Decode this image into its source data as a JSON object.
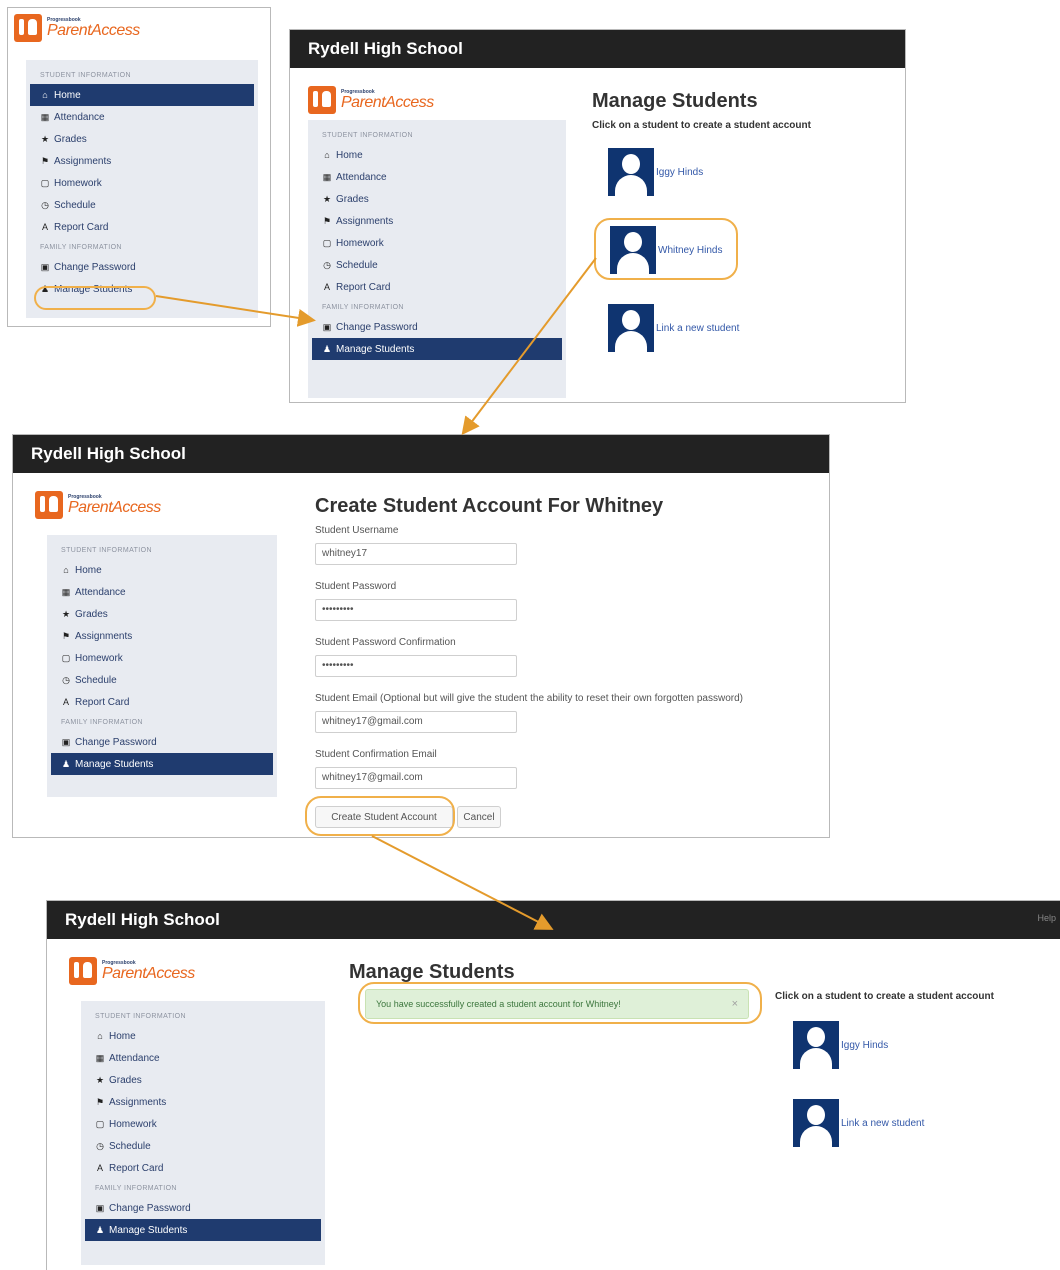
{
  "panel1": {
    "logo_small": "Progressbook",
    "logo_big": "ParentAccess",
    "sections": [
      {
        "heading": "STUDENT INFORMATION",
        "items": [
          {
            "label": "Home",
            "icon": "home-icon",
            "glyph": "⌂",
            "active": true
          },
          {
            "label": "Attendance",
            "icon": "calendar-icon",
            "glyph": "▦"
          },
          {
            "label": "Grades",
            "icon": "star-icon",
            "glyph": "★"
          },
          {
            "label": "Assignments",
            "icon": "flag-icon",
            "glyph": "⚑"
          },
          {
            "label": "Homework",
            "icon": "book-icon",
            "glyph": "▢"
          },
          {
            "label": "Schedule",
            "icon": "clock-icon",
            "glyph": "◷"
          },
          {
            "label": "Report Card",
            "icon": "report-card-icon",
            "glyph": "A"
          }
        ]
      },
      {
        "heading": "FAMILY INFORMATION",
        "items": [
          {
            "label": "Change Password",
            "icon": "lock-icon",
            "glyph": "▣"
          },
          {
            "label": "Manage Students",
            "icon": "user-icon",
            "glyph": "♟"
          }
        ]
      }
    ]
  },
  "panel2": {
    "school": "Rydell High School",
    "logo_small": "Progressbook",
    "logo_big": "ParentAccess",
    "sections": [
      {
        "heading": "STUDENT INFORMATION",
        "items": [
          {
            "label": "Home",
            "icon": "home-icon",
            "glyph": "⌂"
          },
          {
            "label": "Attendance",
            "icon": "calendar-icon",
            "glyph": "▦"
          },
          {
            "label": "Grades",
            "icon": "star-icon",
            "glyph": "★"
          },
          {
            "label": "Assignments",
            "icon": "flag-icon",
            "glyph": "⚑"
          },
          {
            "label": "Homework",
            "icon": "book-icon",
            "glyph": "▢"
          },
          {
            "label": "Schedule",
            "icon": "clock-icon",
            "glyph": "◷"
          },
          {
            "label": "Report Card",
            "icon": "report-card-icon",
            "glyph": "A"
          }
        ]
      },
      {
        "heading": "FAMILY INFORMATION",
        "items": [
          {
            "label": "Change Password",
            "icon": "lock-icon",
            "glyph": "▣"
          },
          {
            "label": "Manage Students",
            "icon": "user-icon",
            "glyph": "♟",
            "active": true
          }
        ]
      }
    ],
    "title": "Manage Students",
    "hint": "Click on a student to create a student account",
    "students": [
      "Iggy Hinds",
      "Whitney Hinds",
      "Link a new student"
    ]
  },
  "panel3": {
    "school": "Rydell High School",
    "logo_small": "Progressbook",
    "logo_big": "ParentAccess",
    "sections": [
      {
        "heading": "STUDENT INFORMATION",
        "items": [
          {
            "label": "Home",
            "icon": "home-icon",
            "glyph": "⌂"
          },
          {
            "label": "Attendance",
            "icon": "calendar-icon",
            "glyph": "▦"
          },
          {
            "label": "Grades",
            "icon": "star-icon",
            "glyph": "★"
          },
          {
            "label": "Assignments",
            "icon": "flag-icon",
            "glyph": "⚑"
          },
          {
            "label": "Homework",
            "icon": "book-icon",
            "glyph": "▢"
          },
          {
            "label": "Schedule",
            "icon": "clock-icon",
            "glyph": "◷"
          },
          {
            "label": "Report Card",
            "icon": "report-card-icon",
            "glyph": "A"
          }
        ]
      },
      {
        "heading": "FAMILY INFORMATION",
        "items": [
          {
            "label": "Change Password",
            "icon": "lock-icon",
            "glyph": "▣"
          },
          {
            "label": "Manage Students",
            "icon": "user-icon",
            "glyph": "♟",
            "active": true
          }
        ]
      }
    ],
    "title": "Create Student Account For Whitney",
    "fields": [
      {
        "label": "Student Username",
        "value": "whitney17"
      },
      {
        "label": "Student Password",
        "value": "•••••••••"
      },
      {
        "label": "Student Password Confirmation",
        "value": "•••••••••"
      },
      {
        "label": "Student Email (Optional but will give the student the ability to reset their own forgotten password)",
        "value": "whitney17@gmail.com"
      },
      {
        "label": "Student Confirmation Email",
        "value": "whitney17@gmail.com"
      }
    ],
    "create_label": "Create Student Account",
    "cancel_label": "Cancel"
  },
  "panel4": {
    "school": "Rydell High School",
    "help": "Help",
    "logo_small": "Progressbook",
    "logo_big": "ParentAccess",
    "sections": [
      {
        "heading": "STUDENT INFORMATION",
        "items": [
          {
            "label": "Home",
            "icon": "home-icon",
            "glyph": "⌂"
          },
          {
            "label": "Attendance",
            "icon": "calendar-icon",
            "glyph": "▦"
          },
          {
            "label": "Grades",
            "icon": "star-icon",
            "glyph": "★"
          },
          {
            "label": "Assignments",
            "icon": "flag-icon",
            "glyph": "⚑"
          },
          {
            "label": "Homework",
            "icon": "book-icon",
            "glyph": "▢"
          },
          {
            "label": "Schedule",
            "icon": "clock-icon",
            "glyph": "◷"
          },
          {
            "label": "Report Card",
            "icon": "report-card-icon",
            "glyph": "A"
          }
        ]
      },
      {
        "heading": "FAMILY INFORMATION",
        "items": [
          {
            "label": "Change Password",
            "icon": "lock-icon",
            "glyph": "▣"
          },
          {
            "label": "Manage Students",
            "icon": "user-icon",
            "glyph": "♟",
            "active": true
          }
        ]
      }
    ],
    "title": "Manage Students",
    "alert": "You have successfully created a student account for Whitney!",
    "alert_close": "×",
    "hint": "Click on a student to create a student account",
    "students": [
      "Iggy Hinds",
      "Link a new student"
    ]
  },
  "colors": {
    "accent_orange": "#e8671f",
    "nav_active": "#1f3b6f",
    "highlight": "#f0b04a",
    "titlebar": "#222222",
    "success_bg": "#dff0d8"
  }
}
